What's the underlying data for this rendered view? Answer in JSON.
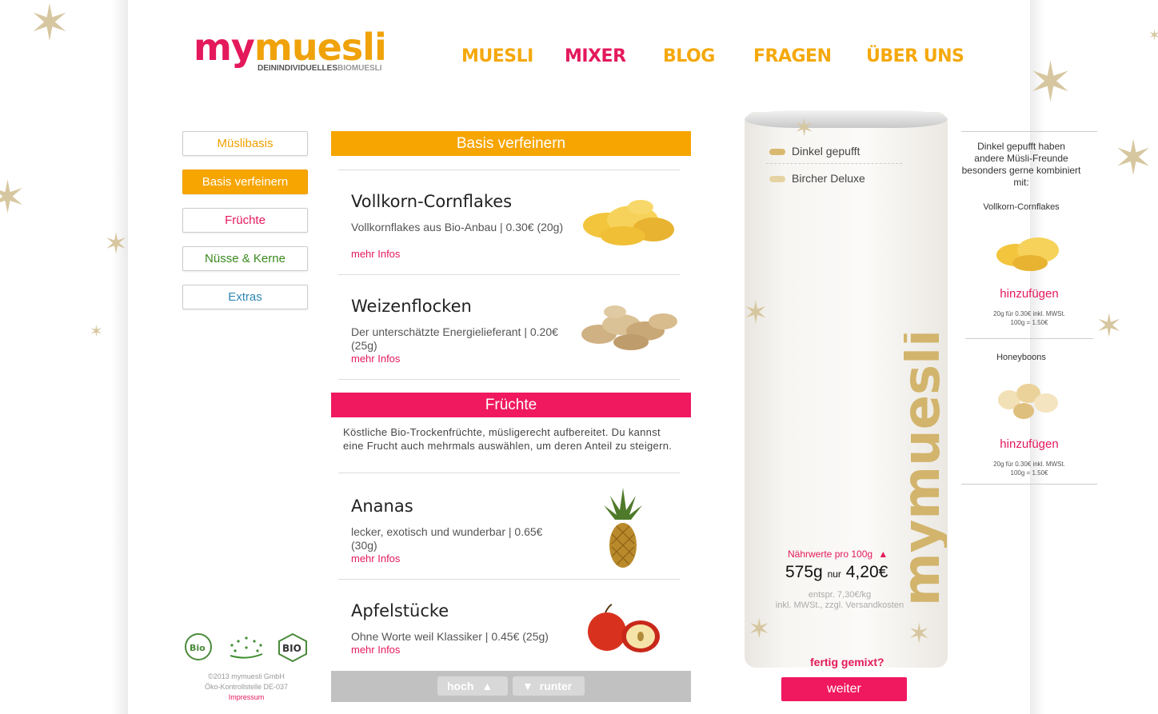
{
  "logo": {
    "my": "my",
    "muesli": "muesli",
    "tagline_a": "DEININDIVIDUELLES",
    "tagline_b": "BIOMUESLI"
  },
  "nav": [
    {
      "label": "MUESLI",
      "active": false
    },
    {
      "label": "MIXER",
      "active": true
    },
    {
      "label": "BLOG",
      "active": false
    },
    {
      "label": "FRAGEN",
      "active": false
    },
    {
      "label": "ÜBER UNS",
      "active": false
    }
  ],
  "categories": [
    {
      "label": "Müslibasis",
      "color": "#f0a000",
      "active": false
    },
    {
      "label": "Basis verfeinern",
      "color": "#ffffff",
      "active": true
    },
    {
      "label": "Früchte",
      "color": "#e4195c",
      "active": false
    },
    {
      "label": "Nüsse & Kerne",
      "color": "#3a8a1d",
      "active": false
    },
    {
      "label": "Extras",
      "color": "#2e86b5",
      "active": false
    }
  ],
  "sections": {
    "basis": "Basis verfeinern",
    "fruechte": "Früchte",
    "fruechte_desc": "Köstliche Bio-Trockenfrüchte, müsligerecht aufbereitet. Du kannst eine Frucht auch mehrmals auswählen, um deren Anteil zu steigern."
  },
  "items": [
    {
      "title": "Vollkorn-Cornflakes",
      "desc": "Vollkornflakes aus Bio-Anbau | 0.30€ (20g)",
      "more": "mehr Infos",
      "image": "cornflakes"
    },
    {
      "title": "Weizenflocken",
      "desc": "Der unterschätzte Energielieferant | 0.20€ (25g)",
      "more": "mehr Infos",
      "image": "wheat-flakes"
    },
    {
      "title": "Ananas",
      "desc": "lecker, exotisch und wunderbar | 0.65€ (30g)",
      "more": "mehr Infos",
      "image": "pineapple"
    },
    {
      "title": "Apfelstücke",
      "desc": "Ohne Worte weil Klassiker | 0.45€ (25g)",
      "more": "mehr Infos",
      "image": "apple"
    }
  ],
  "pager": {
    "up": "hoch",
    "down": "runter"
  },
  "tube": {
    "brand": "mymuesli",
    "entries": [
      "Dinkel gepufft",
      "Bircher Deluxe"
    ],
    "nutrition_link": "Nährwerte pro 100g",
    "weight": "575g",
    "nur": "nur",
    "price": "4,20€",
    "per_kg": "entspr. 7,30€/kg",
    "tax": "inkl. MWSt., zzgl. Versandkosten"
  },
  "finish": {
    "question": "fertig gemixt?",
    "button": "weiter"
  },
  "suggestions": {
    "intro": "Dinkel gepufft haben andere Müsli-Freunde besonders gerne kombiniert mit:",
    "items": [
      {
        "name": "Vollkorn-Cornflakes",
        "add": "hinzufügen",
        "price_a": "20g für 0.30€ inkl. MWSt.",
        "price_b": "100g = 1.50€"
      },
      {
        "name": "Honeyboons",
        "add": "hinzufügen",
        "price_a": "20g für 0.30€ inkl. MWSt.",
        "price_b": "100g = 1.50€"
      }
    ]
  },
  "footer": {
    "copyright": "©2013 mymuesli GmbH",
    "control": "Öko-Kontrollstelle DE-037",
    "impressum": "Impressum",
    "seal_bio": "Bio",
    "seal_bio2": "BIO"
  },
  "colors": {
    "orange": "#f7a500",
    "pink": "#f0185f",
    "gold": "#d7c7a0"
  }
}
